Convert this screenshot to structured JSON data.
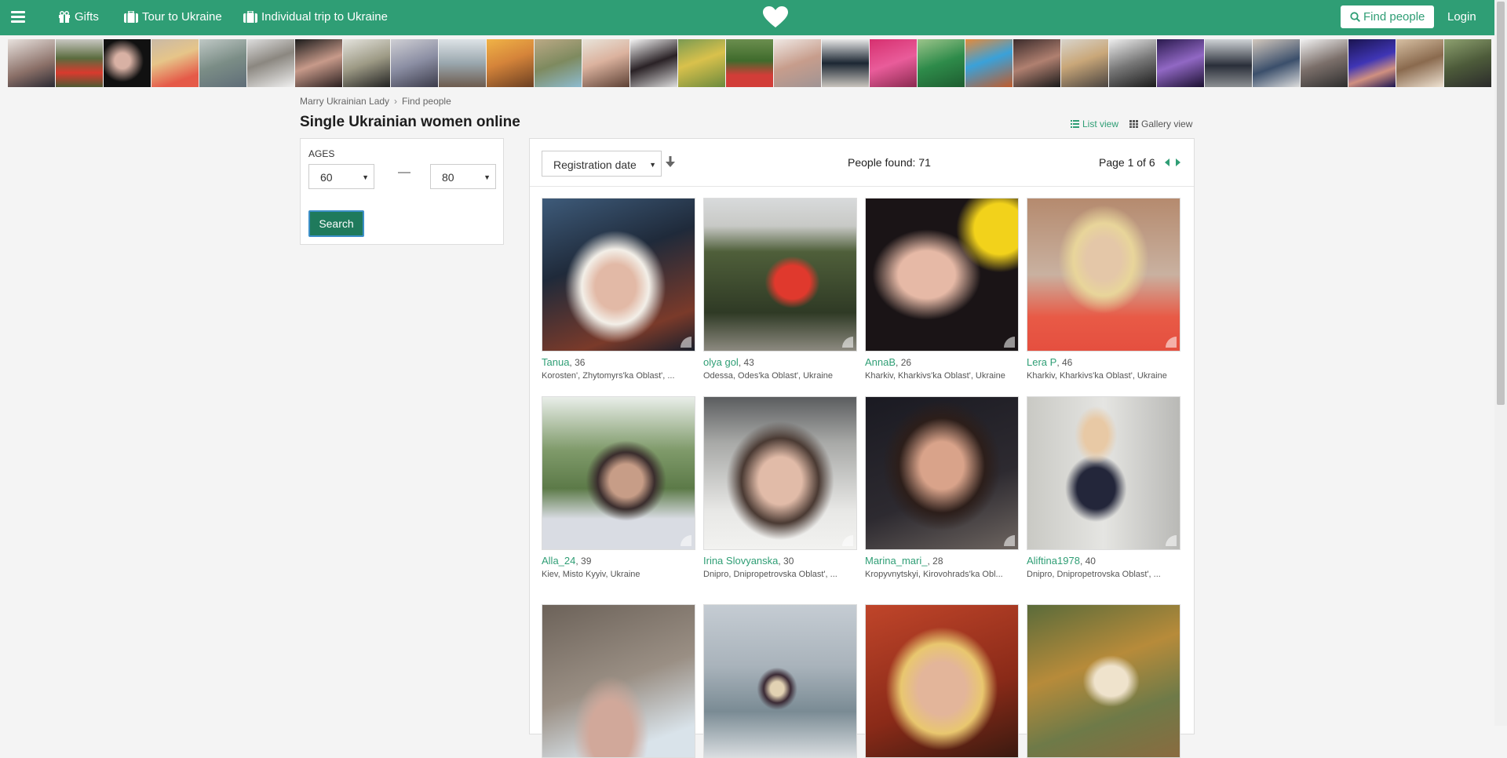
{
  "nav": {
    "gifts": "Gifts",
    "tour": "Tour to Ukraine",
    "individual": "Individual trip to Ukraine",
    "find_people": "Find people",
    "login": "Login"
  },
  "breadcrumb": {
    "home": "Marry Ukrainian Lady",
    "separator": "›",
    "current": "Find people"
  },
  "page_title": "Single Ukrainian women online",
  "views": {
    "list": "List view",
    "gallery": "Gallery view"
  },
  "filter": {
    "ages_label": "AGES",
    "age_from": "60",
    "age_to": "80",
    "dash": "—",
    "search_label": "Search"
  },
  "results": {
    "sort_value": "Registration date",
    "found": "People found: 71",
    "page": "Page 1 of 6"
  },
  "profiles": [
    {
      "name": "Tanua",
      "age": ", 36",
      "location": "Korosten', Zhytomyrs'ka Oblast', ..."
    },
    {
      "name": "olya gol",
      "age": ", 43",
      "location": "Odessa, Odes'ka Oblast', Ukraine"
    },
    {
      "name": "AnnaB",
      "age": ", 26",
      "location": "Kharkiv, Kharkivs'ka Oblast', Ukraine"
    },
    {
      "name": "Lera P",
      "age": ", 46",
      "location": "Kharkiv, Kharkivs'ka Oblast', Ukraine"
    },
    {
      "name": "Alla_24",
      "age": ", 39",
      "location": "Kiev, Misto Kyyiv, Ukraine"
    },
    {
      "name": "Irina Slovyanska",
      "age": ", 30",
      "location": "Dnipro, Dnipropetrovska Oblast', ..."
    },
    {
      "name": "Marina_mari_",
      "age": ", 28",
      "location": "Kropyvnytskyi, Kirovohrads'ka Obl..."
    },
    {
      "name": "Aliftina1978",
      "age": ", 40",
      "location": "Dnipro, Dnipropetrovska Oblast', ..."
    }
  ],
  "colors": {
    "brand": "#2f9e75",
    "button": "#1f7a5c"
  },
  "icons": [
    "menu-icon",
    "gift-icon",
    "suitcase-icon",
    "heart-icon",
    "search-icon",
    "list-icon",
    "grid-icon",
    "sort-down-icon",
    "caret-left-icon",
    "caret-right-icon"
  ]
}
